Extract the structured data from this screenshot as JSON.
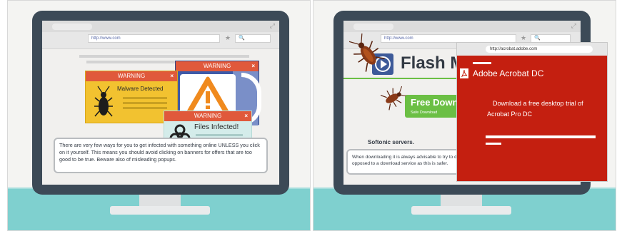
{
  "left_panel": {
    "browser": {
      "url": "http://www.com",
      "star": "★",
      "search": "🔍",
      "resize": "⤢"
    },
    "popups": {
      "malware": {
        "header": "WARNING",
        "close": "×",
        "text": "Malware Detected"
      },
      "alert": {
        "header": "WARNING",
        "close": "×"
      },
      "files": {
        "header": "WARNING",
        "close": "×",
        "text": "Files Infected!"
      }
    },
    "message": "There are very few ways for you to get infected with something online UNLESS you click on it yourself. This means you should avoid clicking on banners for offers that are too good to be true. Beware also of misleading popups."
  },
  "right_panel": {
    "browser": {
      "url": "http://www.com",
      "star": "★",
      "search": "🔍",
      "resize": "⤢"
    },
    "flash_title": "Flash M",
    "download_button": {
      "label": "Free Down",
      "sublabel": "Safe Download"
    },
    "softonic": "Softonic servers.",
    "acrobat_popup": {
      "url": "http://acrobat.adobe.com",
      "title": "Adobe Acrobat DC",
      "body": "Download a free desktop trial of Acrobat Pro DC"
    },
    "message": "When downloading it is always advisable to try to download it from the developer's site as opposed to a download service as this is safer."
  },
  "colors": {
    "desk": "#7fd0cf",
    "monitor": "#3c4a57",
    "warning_header": "#e0593b",
    "popup_yellow": "#f2c230",
    "popup_teal": "#d4ecea",
    "popup_blue": "#3e5aa8",
    "acrobat_red": "#c41f10",
    "download_green": "#6bbf44"
  }
}
